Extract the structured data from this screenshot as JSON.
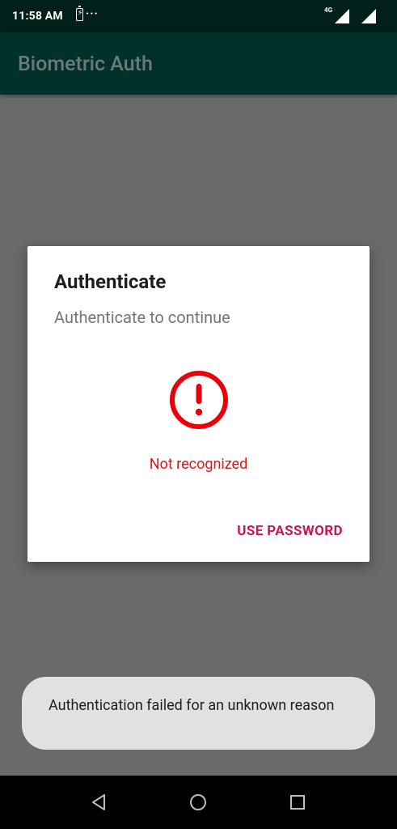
{
  "status_bar": {
    "time": "11:58 AM",
    "dots": "···",
    "network_type": "4G",
    "icons": [
      "battery-charging-icon",
      "signal-icon",
      "signal-icon"
    ]
  },
  "app_bar": {
    "title": "Biometric Auth"
  },
  "dialog": {
    "title": "Authenticate",
    "subtitle": "Authenticate to continue",
    "icon": "error-icon",
    "status_text": "Not recognized",
    "negative_button": "USE PASSWORD"
  },
  "toast": {
    "message": "Authentication failed for an unknown reason"
  },
  "nav_bar": {
    "buttons": [
      "back-icon",
      "home-icon",
      "recents-icon"
    ]
  },
  "colors": {
    "status_bar": "#01201a",
    "app_bar": "#00312a",
    "scrim": "#6a6a6a",
    "error": "#d81b1b",
    "accent": "#c2185b",
    "toast_bg": "#e1e1e1"
  }
}
